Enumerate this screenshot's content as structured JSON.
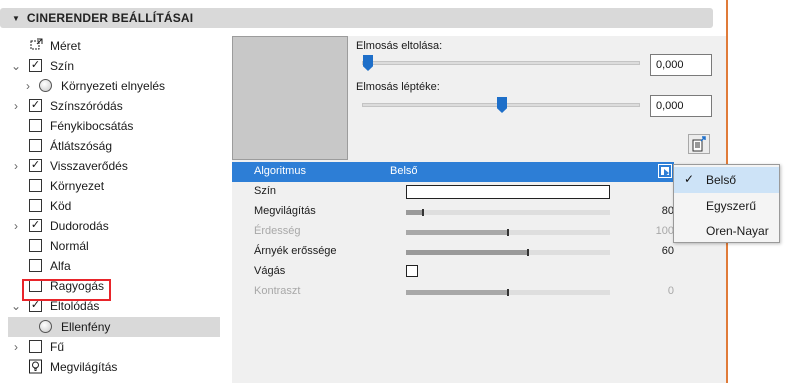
{
  "panel": {
    "title": "CINERENDER BEÁLLÍTÁSAI"
  },
  "tree": {
    "items": [
      {
        "label": "Méret",
        "icon": "resize-icon",
        "checked": null,
        "chevron": false,
        "indent": 0
      },
      {
        "label": "Szín",
        "checked": true,
        "chevron": true,
        "indent": 0
      },
      {
        "label": "Környezeti elnyelés",
        "icon": "sphere-icon",
        "chevron": true,
        "indent": 1
      },
      {
        "label": "Színszóródás",
        "checked": true,
        "chevron": true,
        "indent": 0
      },
      {
        "label": "Fénykibocsátás",
        "checked": false,
        "chevron": false,
        "indent": 0
      },
      {
        "label": "Átlátszóság",
        "checked": false,
        "chevron": false,
        "indent": 0
      },
      {
        "label": "Visszaverődés",
        "checked": true,
        "chevron": true,
        "indent": 0
      },
      {
        "label": "Környezet",
        "checked": false,
        "chevron": false,
        "indent": 0
      },
      {
        "label": "Köd",
        "checked": false,
        "chevron": false,
        "indent": 0
      },
      {
        "label": "Dudorodás",
        "checked": true,
        "chevron": true,
        "indent": 0
      },
      {
        "label": "Normál",
        "checked": false,
        "chevron": false,
        "indent": 0
      },
      {
        "label": "Alfa",
        "checked": false,
        "chevron": false,
        "indent": 0
      },
      {
        "label": "Ragyogás",
        "checked": false,
        "chevron": false,
        "indent": 0
      },
      {
        "label": "Eltolódás",
        "checked": true,
        "chevron": true,
        "indent": 0
      },
      {
        "label": "Ellenfény",
        "icon": "sphere-icon",
        "chevron": false,
        "indent": 1,
        "selected": true
      },
      {
        "label": "Fű",
        "checked": false,
        "chevron": true,
        "indent": 0
      },
      {
        "label": "Megvilágítás",
        "icon": "lightbulb-icon",
        "chevron": false,
        "indent": 0
      }
    ]
  },
  "sliders": {
    "blur_offset": {
      "label": "Elmosás eltolása:",
      "value": "0,000",
      "position": 0.0
    },
    "blur_scale": {
      "label": "Elmosás léptéke:",
      "value": "0,000",
      "position": 0.5
    }
  },
  "properties": {
    "rows": [
      {
        "name": "Algoritmus",
        "value": "Belső",
        "kind": "dropdown"
      },
      {
        "name": "Szín",
        "kind": "color"
      },
      {
        "name": "Megvilágítás",
        "kind": "bar",
        "number": "80",
        "fill": 0.08
      },
      {
        "name": "Érdesség",
        "kind": "bar",
        "number": "100",
        "fill": 0.5,
        "disabled": true
      },
      {
        "name": "Árnyék erőssége",
        "kind": "bar",
        "number": "60",
        "fill": 0.6
      },
      {
        "name": "Vágás",
        "kind": "checkbox",
        "checked": false
      },
      {
        "name": "Kontraszt",
        "kind": "bar",
        "number": "0",
        "fill": 0.5,
        "disabled": true
      }
    ]
  },
  "dropdown": {
    "options": [
      "Belső",
      "Egyszerű",
      "Oren-Nayar"
    ],
    "selected": "Belső"
  },
  "colors": {
    "accent": "#2d7ed6",
    "highlight_border": "#e8242a",
    "divider": "#e07b39"
  }
}
